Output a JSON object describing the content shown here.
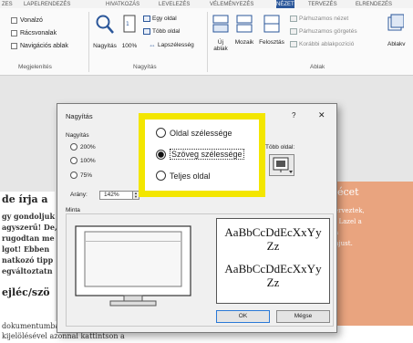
{
  "tabs": [
    "ZES",
    "LAPELRENDEZÉS",
    "HIVATKOZÁS",
    "LEVELEZÉS",
    "VÉLEMÉNYEZÉS",
    "NÉZET",
    "TERVEZÉS",
    "ELRENDEZÉS"
  ],
  "ribbon": {
    "show": {
      "vonalzo": "Vonalzó",
      "racsvonalak": "Rácsvonalak",
      "navigacios": "Navigációs ablak",
      "label": "Megjelenítés"
    },
    "zoom": {
      "nagyitas": "Nagyítás",
      "szazalek": "100%",
      "egy_oldal": "Egy oldal",
      "tobb_oldal": "Több oldal",
      "lapszelesseg": "Lapszélesség",
      "label": "Nagyítás"
    },
    "window": {
      "uj_ablak": "Új ablak",
      "mozaik": "Mozaik",
      "felosztas": "Felosztás",
      "parhuzamos_nezet": "Párhuzamos nézet",
      "parhuzamos_gorgetes": "Párhuzamos görgetés",
      "korabbi": "Korábbi ablakpozíció",
      "ablakv": "Ablakv",
      "label": "Ablak"
    }
  },
  "document": {
    "heading1": "de írja a",
    "lines": [
      "gy gondoljuk",
      "agyszerű! De,",
      "rugodtan me",
      "lgot! Ebben",
      "natkozó tipp",
      "egváltoztatn"
    ],
    "heading2": "ejléc/szö",
    "bottom": [
      "dokumentumban lévő bármely szöveg",
      "kijelölésével azonnal kattintson a"
    ],
    "orange_title": "écet",
    "orange_lines": [
      "erveztek,",
      ". Lazel a",
      "a",
      "njust."
    ]
  },
  "dialog": {
    "title": "Nagyítás",
    "help": "?",
    "close": "✕",
    "zoom_group": "Nagyítás",
    "r200": "200%",
    "r100": "100%",
    "r75": "75%",
    "arany_label": "Arány:",
    "arany_value": "142%",
    "tobb_oldal": "Több oldal:",
    "minta": "Minta",
    "sample_lines": [
      "AaBbCcDdEcXxYy",
      "Zz",
      "AaBbCcDdEcXxYy",
      "Zz"
    ],
    "ok": "OK",
    "megse": "Mégse"
  },
  "callout": {
    "oldal": "Oldal szélessége",
    "szoveg": "Szöveg szélessége",
    "teljes": "Teljes oldal",
    "selected": "Szöveg szélessége",
    "border_color": "#f3e600"
  }
}
